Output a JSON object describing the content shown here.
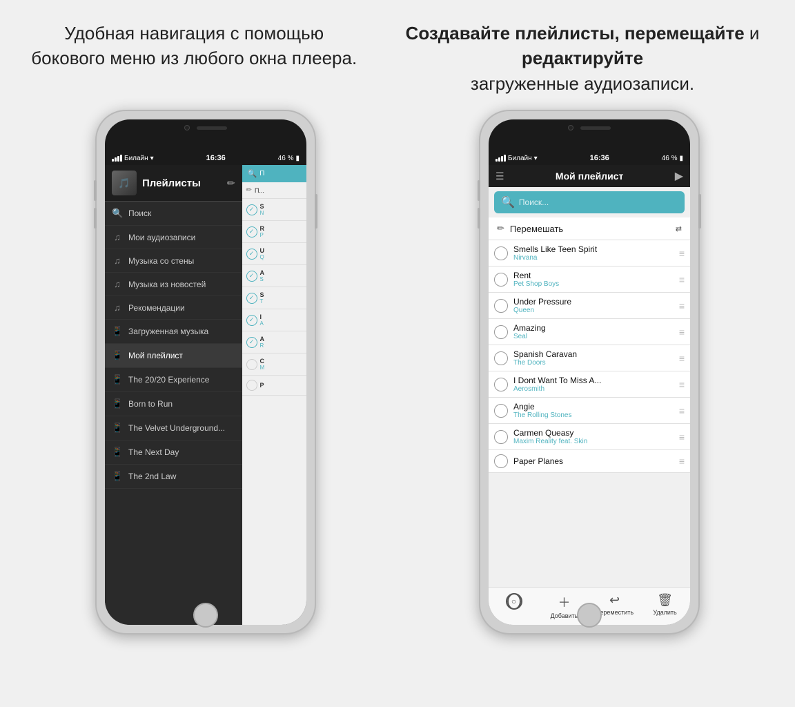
{
  "left_headline": "Удобная навигация с помощью бокового меню из любого окна плеера.",
  "right_headline_normal": "загруженные аудиозаписи.",
  "right_headline_bold": "Создавайте плейлисты, перемещайте",
  "right_headline_middle": " и ",
  "right_headline_bold2": "редактируйте",
  "status": {
    "carrier": "Билайн",
    "wifi": "WiFi",
    "time": "16:36",
    "battery": "46 %"
  },
  "left_phone": {
    "title": "Плейлисты",
    "search_label": "Поиск",
    "menu_items": [
      {
        "icon": "🔍",
        "label": "Поиск"
      },
      {
        "icon": "♫",
        "label": "Мои аудиозаписи"
      },
      {
        "icon": "♫",
        "label": "Музыка со стены"
      },
      {
        "icon": "♫",
        "label": "Музыка из новостей"
      },
      {
        "icon": "♫",
        "label": "Рекомендации"
      },
      {
        "icon": "□",
        "label": "Загруженная музыка"
      },
      {
        "icon": "□",
        "label": "Мой плейлист",
        "active": true
      },
      {
        "icon": "□",
        "label": "The 20/20 Experience"
      },
      {
        "icon": "□",
        "label": "Born to Run"
      },
      {
        "icon": "□",
        "label": "The Velvet Underground..."
      },
      {
        "icon": "□",
        "label": "The Next Day"
      },
      {
        "icon": "□",
        "label": "The 2nd Law"
      }
    ],
    "peek_items": [
      {
        "title": "П",
        "checked": false
      },
      {
        "title": "S",
        "artist": "N",
        "checked": true
      },
      {
        "title": "R",
        "artist": "P",
        "checked": true
      },
      {
        "title": "U",
        "artist": "Q",
        "checked": true
      },
      {
        "title": "A",
        "artist": "S",
        "checked": true
      },
      {
        "title": "S",
        "artist": "T",
        "checked": true
      },
      {
        "title": "I",
        "artist": "A",
        "checked": true
      },
      {
        "title": "A",
        "artist": "R",
        "checked": true
      },
      {
        "title": "C",
        "artist": "M",
        "checked": false
      },
      {
        "title": "P",
        "checked": false
      }
    ]
  },
  "right_phone": {
    "title": "Мой плейлист",
    "search_placeholder": "Поиск...",
    "shuffle_label": "Перемешать",
    "tracks": [
      {
        "name": "Smells Like Teen Spirit",
        "artist": "Nirvana"
      },
      {
        "name": "Rent",
        "artist": "Pet Shop Boys"
      },
      {
        "name": "Under Pressure",
        "artist": "Queen"
      },
      {
        "name": "Amazing",
        "artist": "Seal"
      },
      {
        "name": "Spanish Caravan",
        "artist": "The Doors"
      },
      {
        "name": "I Dont Want To Miss A...",
        "artist": "Aerosmith"
      },
      {
        "name": "Angie",
        "artist": "The Rolling Stones"
      },
      {
        "name": "Carmen Queasy",
        "artist": "Maxim Reality feat. Skin"
      },
      {
        "name": "Paper Planes",
        "artist": ""
      }
    ],
    "toolbar": {
      "add": "Добавить",
      "move": "Переместить",
      "delete": "Удалить"
    }
  }
}
